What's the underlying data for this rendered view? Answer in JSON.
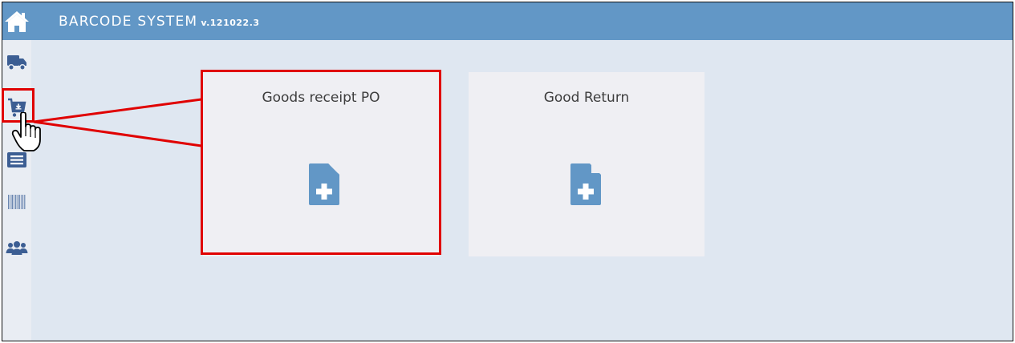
{
  "header": {
    "title": "BARCODE SYSTEM",
    "version": "v.121022.3"
  },
  "sidebar": {
    "items": [
      {
        "icon": "home-icon"
      },
      {
        "icon": "truck-icon"
      },
      {
        "icon": "cart-download-icon"
      },
      {
        "icon": "document-list-icon"
      },
      {
        "icon": "barcode-icon"
      },
      {
        "icon": "users-icon"
      }
    ]
  },
  "cards": [
    {
      "label": "Goods receipt PO",
      "icon": "file-add-icon"
    },
    {
      "label": "Good Return",
      "icon": "file-add-icon"
    }
  ],
  "colors": {
    "topbar": "#6297c6",
    "background": "#dfe7f1",
    "card": "#efeff3",
    "icon_blue": "#6297c6",
    "sidebar_icon": "#3c5e93",
    "highlight": "#e00000"
  },
  "annotation": {
    "cursor": "pointer-hand-icon"
  }
}
